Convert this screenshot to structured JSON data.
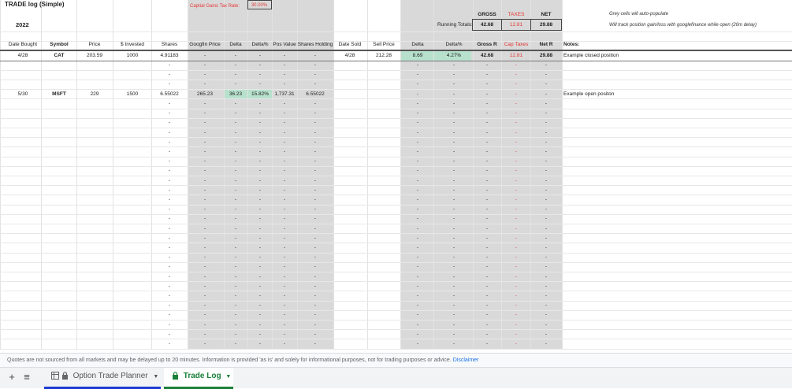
{
  "sheet": {
    "title": "TRADE log (Simple)",
    "year": "2022",
    "tax_rate_label": "Captial Gains Tax Rate:",
    "tax_rate_value": "30.00%",
    "summary": {
      "gross_header": "GROSS",
      "taxes_header": "TAXES",
      "net_header": "NET",
      "running_totals_label": "Running Totals:",
      "gross_value": "42.68",
      "taxes_value": "12.81",
      "net_value": "29.88"
    },
    "notes_hint_1": "Grey cells will auto-populate",
    "notes_hint_2": "Will track position gain/loss with googlefinance while open (20m delay)",
    "headers": {
      "date_bought": "Date Bought",
      "symbol": "Symbol",
      "price": "Price",
      "invested": "$ Invested",
      "shares": "Shares",
      "googfin_price": "Googfin Price",
      "delta": "Delta",
      "delta_pct": "Delta%",
      "pos_value": "Pos Value",
      "shares_holding": "Shares Holding",
      "date_sold": "Date Sold",
      "sell_price": "Sell Price",
      "delta2": "Delta",
      "delta_pct2": "Delta%",
      "gross_r": "Gross R",
      "cap_taxes": "Cap Taxes",
      "net_r": "Net R",
      "notes": "Notes:"
    },
    "row1": {
      "date_bought": "4/28",
      "symbol": "CAT",
      "price": "203.59",
      "invested": "1000",
      "shares": "4.91183",
      "googfin_price": "-",
      "delta": "-",
      "delta_pct": "-",
      "pos_value": "-",
      "shares_holding": "-",
      "date_sold": "4/28",
      "sell_price": "212.28",
      "delta2": "8.69",
      "delta_pct2": "4.27%",
      "gross_r": "42.68",
      "cap_taxes": "12.81",
      "net_r": "29.88",
      "notes": "Example closed position"
    },
    "row2": {
      "date_bought": "5/30",
      "symbol": "MSFT",
      "price": "229",
      "invested": "1500",
      "shares": "6.55022",
      "googfin_price": "265.23",
      "delta": "36.23",
      "delta_pct": "15.82%",
      "pos_value": "1,737.31",
      "shares_holding": "6.55022",
      "date_sold": "",
      "sell_price": "",
      "delta2": "-",
      "delta_pct2": "-",
      "gross_r": "-",
      "cap_taxes": "-",
      "net_r": "-",
      "notes": "Example open positon"
    },
    "empty_cell": "-",
    "empty_row_count": 29
  },
  "footer": {
    "text": "Quotes are not sourced from all markets and may be delayed up to 20 minutes. Information is provided 'as is' and solely for informational purposes, not for trading purposes or advice.",
    "link": "Disclaimer"
  },
  "tabs": [
    {
      "label": "Option Trade Planner",
      "active": false
    },
    {
      "label": "Trade Log",
      "active": true
    }
  ],
  "colors": {
    "grey_cell": "#d9d9d9",
    "green_cell": "#b7e1cd",
    "red_text": "#e53935",
    "active_tab": "#188038",
    "link": "#1a73e8"
  }
}
